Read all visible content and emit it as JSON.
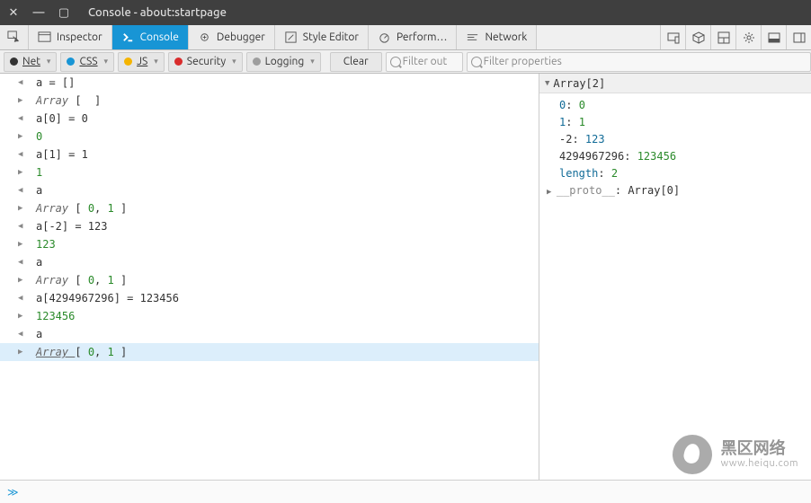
{
  "window": {
    "title": "Console - about:startpage"
  },
  "tabs": {
    "inspector": "Inspector",
    "console": "Console",
    "debugger": "Debugger",
    "style": "Style Editor",
    "perf": "Perform…",
    "network": "Network"
  },
  "filters": {
    "net": "Net",
    "css": "CSS",
    "js": "JS",
    "security": "Security",
    "logging": "Logging",
    "clear": "Clear",
    "filter_out_placeholder": "Filter out",
    "filter_props_placeholder": "Filter properties"
  },
  "colors": {
    "net": "#333333",
    "css": "#1895d5",
    "js": "#f5b400",
    "security": "#d92c2c",
    "logging": "#9e9e9e"
  },
  "console_lines": [
    {
      "dir": "in",
      "text": "a = []"
    },
    {
      "dir": "out",
      "segments": [
        {
          "t": "Array ",
          "cls": "c-kw"
        },
        {
          "t": "[  ]"
        }
      ]
    },
    {
      "dir": "in",
      "text": "a[0] = 0"
    },
    {
      "dir": "out",
      "segments": [
        {
          "t": "0",
          "cls": "c-num"
        }
      ]
    },
    {
      "dir": "in",
      "text": "a[1] = 1"
    },
    {
      "dir": "out",
      "segments": [
        {
          "t": "1",
          "cls": "c-num"
        }
      ]
    },
    {
      "dir": "in",
      "text": "a"
    },
    {
      "dir": "out",
      "segments": [
        {
          "t": "Array ",
          "cls": "c-kw"
        },
        {
          "t": "[ "
        },
        {
          "t": "0",
          "cls": "c-num"
        },
        {
          "t": ", "
        },
        {
          "t": "1",
          "cls": "c-num"
        },
        {
          "t": " ]"
        }
      ]
    },
    {
      "dir": "in",
      "text": "a[-2] = 123"
    },
    {
      "dir": "out",
      "segments": [
        {
          "t": "123",
          "cls": "c-num"
        }
      ]
    },
    {
      "dir": "in",
      "text": "a"
    },
    {
      "dir": "out",
      "segments": [
        {
          "t": "Array ",
          "cls": "c-kw"
        },
        {
          "t": "[ "
        },
        {
          "t": "0",
          "cls": "c-num"
        },
        {
          "t": ", "
        },
        {
          "t": "1",
          "cls": "c-num"
        },
        {
          "t": " ]"
        }
      ]
    },
    {
      "dir": "in",
      "text": "a[4294967296] = 123456"
    },
    {
      "dir": "out",
      "segments": [
        {
          "t": "123456",
          "cls": "c-num"
        }
      ]
    },
    {
      "dir": "in",
      "text": "a"
    },
    {
      "dir": "out",
      "selected": true,
      "segments": [
        {
          "t": "Array ",
          "cls": "c-kw c-link"
        },
        {
          "t": "[ "
        },
        {
          "t": "0",
          "cls": "c-num"
        },
        {
          "t": ", "
        },
        {
          "t": "1",
          "cls": "c-num"
        },
        {
          "t": " ]"
        }
      ]
    }
  ],
  "inspector": {
    "header": "Array[2]",
    "entries": [
      {
        "key": "0",
        "keyCls": "k-idx",
        "val": "0",
        "valCls": "k-num"
      },
      {
        "key": "1",
        "keyCls": "k-idx",
        "val": "1",
        "valCls": "k-num"
      },
      {
        "key": "-2",
        "keyCls": "",
        "val": "123",
        "valCls": "k-val"
      },
      {
        "key": "4294967296",
        "keyCls": "",
        "val": "123456",
        "valCls": "k-num"
      },
      {
        "key": "length",
        "keyCls": "k-idx",
        "val": "2",
        "valCls": "k-num"
      },
      {
        "key": "__proto__",
        "keyCls": "k-gray",
        "val": "Array[0]",
        "valCls": "",
        "expandable": true
      }
    ]
  },
  "prompt": "≫",
  "watermark": {
    "big": "黑区网络",
    "small": "www.heiqu.com"
  }
}
